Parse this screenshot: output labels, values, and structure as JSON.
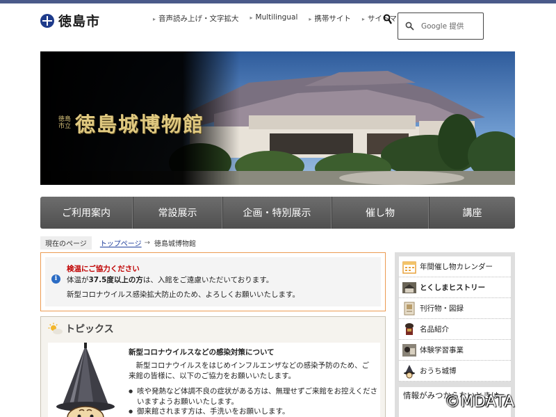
{
  "header": {
    "site_name": "徳島市",
    "utility_links": [
      "音声読み上げ・文字拡大",
      "Multilingual",
      "携帯サイト",
      "サイトマップ"
    ],
    "search_placeholder": "Google 提供"
  },
  "hero": {
    "subtitle_line1": "徳島",
    "subtitle_line2": "市立",
    "title": "徳島城博物館"
  },
  "nav": {
    "items": [
      "ご利用案内",
      "常設展示",
      "企画・特別展示",
      "催し物",
      "講座"
    ]
  },
  "breadcrumb": {
    "here_label": "現在のページ",
    "top_link": "トップページ",
    "arrow": "→",
    "current": "徳島城博物館"
  },
  "notice": {
    "title": "検温にご協力ください",
    "line1_prefix": "体温が",
    "line1_bold": "37.5度以上の方",
    "line1_suffix": "は、入館をご遠慮いただいております。",
    "line2": "新型コロナウイルス感染拡大防止のため、よろしくお願いいたします。"
  },
  "topics": {
    "title": "トピックス",
    "heading": "新型コロナウイルスなどの感染対策について",
    "body": "　新型コロナウイルスをはじめインフルエンザなどの感染予防のため、ご来館の皆様に、以下のご協力をお願いいたします。",
    "bullets": [
      "咳や発熱など体調不良の症状がある方は、無理せずご来館をお控えくださいますようお願いいたします。",
      "御来館されます方は、手洗いをお願いします。"
    ]
  },
  "sidebar": {
    "items": [
      {
        "label": "年間催し物カレンダー",
        "icon": "calendar-icon"
      },
      {
        "label": "とくしまヒストリー",
        "icon": "history-icon"
      },
      {
        "label": "刊行物・図録",
        "icon": "book-icon"
      },
      {
        "label": "名品紹介",
        "icon": "armor-icon"
      },
      {
        "label": "体験学習事業",
        "icon": "workshop-icon"
      },
      {
        "label": "おうち城博",
        "icon": "castle-icon"
      }
    ],
    "help_text": "情報がみつからないときは"
  },
  "watermark": "©MDATA",
  "colors": {
    "nav_bg": "#5d5d5d",
    "notice_border": "#ec9a50",
    "notice_title": "#c00000",
    "link": "#1a3a9a",
    "logo": "#1e3b8b"
  }
}
